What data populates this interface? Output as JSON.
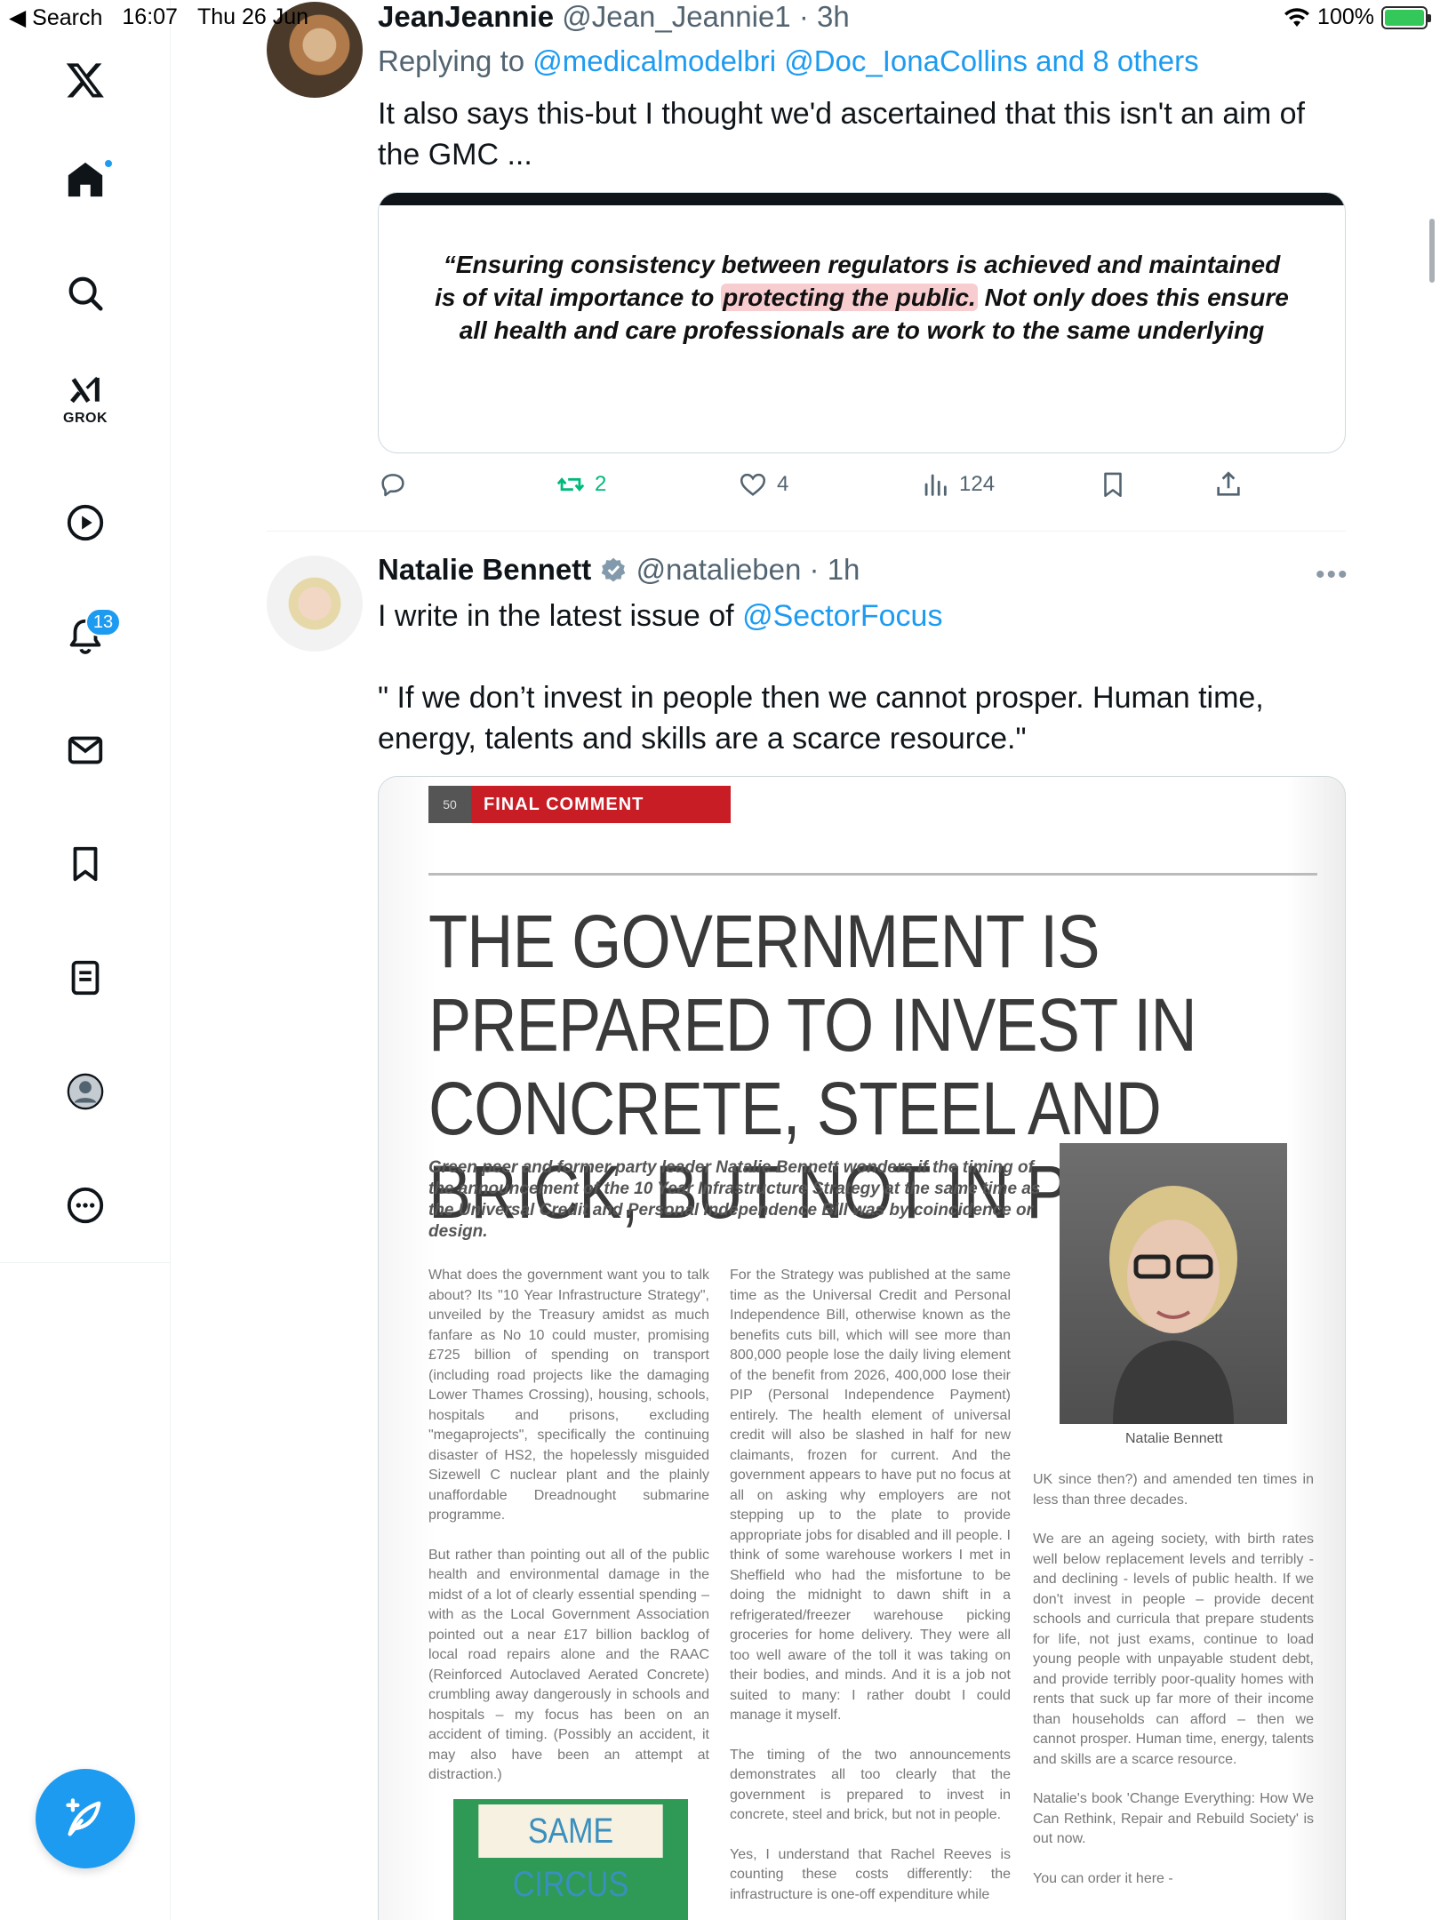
{
  "status_bar": {
    "back_label": "◀ Search",
    "time": "16:07",
    "date": "Thu 26 Jun",
    "battery": "100%",
    "battery_level": 1.0
  },
  "nav": {
    "items": [
      "x-logo-icon",
      "home-icon",
      "search-icon",
      "grok-icon",
      "video-icon",
      "notifications-icon",
      "messages-icon",
      "bookmarks-icon",
      "lists-icon",
      "profile-icon",
      "more-icon"
    ],
    "grok_label": "GROK",
    "notifications_count": "13"
  },
  "tweet1": {
    "name": "JeanJeannie",
    "handle": "@Jean_Jeannie1",
    "time": "· 3h",
    "replying_prefix": "Replying to ",
    "replying_to": "@medicalmodelbri @Doc_IonaCollins and 8 others",
    "text": "It also says this-but I thought we'd ascertained that this isn't an aim of the GMC ...",
    "quote_part1": "“Ensuring consistency between regulators is achieved and maintained is of vital importance to ",
    "quote_highlight": "protecting the public.",
    "quote_part2": " Not only does this ensure all health and care professionals are to work to the same underlying",
    "retweets": "2",
    "likes": "4",
    "views": "124"
  },
  "tweet2": {
    "name": "Natalie Bennett",
    "handle": "@natalieben",
    "time": "· 1h",
    "text_prefix": "I write in the latest issue of ",
    "mention": "@SectorFocus",
    "quote_text": "\" If we don’t invest in people then we cannot prosper. Human time, energy, talents and skills are a scarce resource.\"",
    "article": {
      "page_number": "50",
      "section": "FINAL COMMENT",
      "headline": "THE GOVERNMENT IS PREPARED TO INVEST IN CONCRETE, STEEL AND BRICK, BUT NOT IN PEOPLE",
      "standfirst": "Green peer and former party leader Natalie Bennett wonders if the timing of the announcement of the 10 Year Infrastructure Strategy at the same time as the Universal Credit and Personal Independence Bill was by coincidence or design.",
      "photo_caption": "Natalie Bennett",
      "col1": [
        "What does the government want you to talk about? Its \"10 Year Infrastructure Strategy\", unveiled by the Treasury amidst as much fanfare as No 10 could muster, promising £725 billion of spending on transport (including road projects like the damaging Lower Thames Crossing), housing, schools, hospitals and prisons, excluding \"megaprojects\", specifically the continuing disaster of HS2, the hopelessly misguided Sizewell C nuclear plant and the plainly unaffordable Dreadnought submarine programme.",
        "But rather than pointing out all of the public health and environmental damage in the midst of a lot of clearly essential spending – with as the Local Government Association pointed out a near £17 billion backlog of local road repairs alone and the RAAC (Reinforced Autoclaved Aerated Concrete) crumbling away dangerously in schools and hospitals – my focus has been on an accident of timing. (Possibly an accident, it may also have been an attempt at distraction.)"
      ],
      "col2": [
        "For the Strategy was published at the same time as the Universal Credit and Personal Independence Bill, otherwise known as the benefits cuts bill, which will see more than 800,000 people lose the daily living element of the benefit from 2026, 400,000 lose their PIP (Personal Independence Payment) entirely. The health element of universal credit will also be slashed in half for new claimants, frozen for current. And the government appears to have put no focus at all on asking why employers are not stepping up to the plate to provide appropriate jobs for disabled and ill people. I think of some warehouse workers I met in Sheffield who had the misfortune to be doing the midnight to dawn shift in a refrigerated/freezer warehouse picking groceries for home delivery. They were all too well aware of the toll it was taking on their bodies, and minds. And it is a job not suited to many: I rather doubt I could manage it myself.",
        "The timing of the two announcements demonstrates all too clearly that the government is prepared to invest in concrete, steel and brick, but not in people.",
        "Yes, I understand that Rachel Reeves is counting these costs differently: the infrastructure is one-off expenditure while"
      ],
      "col3": [
        "UK since then?) and amended ten times in less than three decades.",
        "We are an ageing society, with birth rates well below replacement levels and terribly - and declining - levels of public health. If we don't invest in people – provide decent schools and curricula that prepare students for life, not just exams, continue to load young people with unpayable student debt, and provide terribly poor-quality homes with rents that suck up far more of their income than households can afford – then we cannot prosper. Human time, energy, talents and skills are a scarce resource.",
        "Natalie's book 'Change Everything: How We Can Rethink, Repair and Rebuild Society' is out now.",
        "You can order it here -"
      ],
      "book_title": "SAME CIRCUS"
    }
  },
  "colors": {
    "accent": "#1d9bf0",
    "retweet_green": "#00ba7c",
    "muted": "#536471",
    "banner_red": "#c81d25"
  }
}
